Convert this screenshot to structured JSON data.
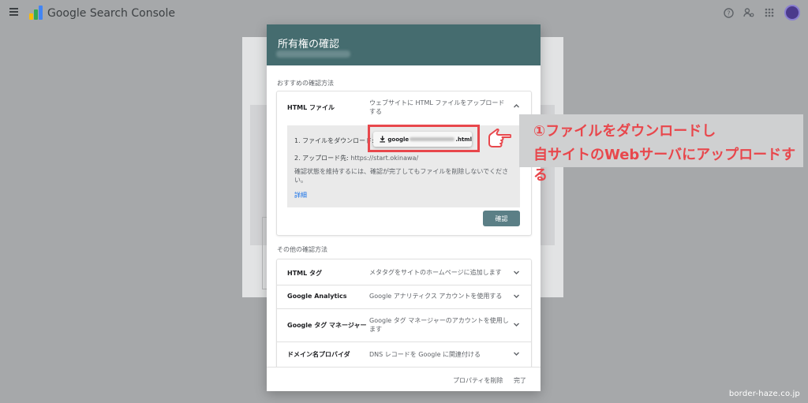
{
  "app": {
    "title": "Google Search Console"
  },
  "topbar": {
    "icons": [
      "help-icon",
      "manage-account-icon",
      "apps-grid-icon",
      "avatar"
    ]
  },
  "dialog": {
    "title": "所有権の確認",
    "recommended_label": "おすすめの確認方法",
    "html_file": {
      "title": "HTML ファイル",
      "description": "ウェブサイトに HTML ファイルをアップロードする",
      "step1_label": "1. ファイルをダウンロード:",
      "download_prefix": "google",
      "download_suffix": ".html",
      "step2_label": "2. アップロード先:",
      "step2_url": "https://start.okinawa/",
      "note": "確認状態を維持するには、確認が完了してもファイルを削除しないでください。",
      "detail_link": "詳細",
      "confirm_button": "確認"
    },
    "other_label": "その他の確認方法",
    "other_methods": [
      {
        "title": "HTML タグ",
        "description": "メタタグをサイトのホームページに追加します"
      },
      {
        "title": "Google Analytics",
        "description": "Google アナリティクス アカウントを使用する"
      },
      {
        "title": "Google タグ マネージャー",
        "description": "Google タグ マネージャーのアカウントを使用します"
      },
      {
        "title": "ドメイン名プロバイダ",
        "description": "DNS レコードを Google に関連付ける"
      }
    ],
    "footer": {
      "remove_property": "プロパティを削除",
      "done": "完了"
    }
  },
  "annotation": {
    "line1": "①ファイルをダウンロードし",
    "line2": "自サイトのWebサーバにアップロードする",
    "color": "#e8474c"
  },
  "watermark": "border-haze.co.jp",
  "colors": {
    "dialog_header": "#456c6f",
    "confirm_button": "#5b7f86",
    "link": "#1a73e8"
  }
}
